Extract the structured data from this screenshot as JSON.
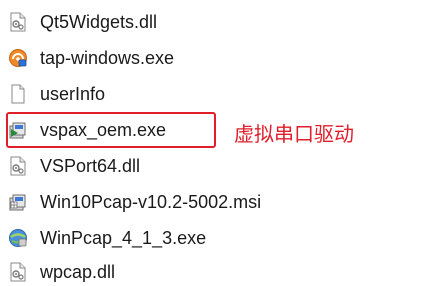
{
  "files": [
    {
      "name": "Qt5Widgets.dll",
      "icon": "dll-file-icon"
    },
    {
      "name": "tap-windows.exe",
      "icon": "tap-windows-exe-icon"
    },
    {
      "name": "userInfo",
      "icon": "blank-file-icon"
    },
    {
      "name": "vspax_oem.exe",
      "icon": "installer-exe-icon"
    },
    {
      "name": "VSPort64.dll",
      "icon": "dll-file-icon"
    },
    {
      "name": "Win10Pcap-v10.2-5002.msi",
      "icon": "msi-installer-icon"
    },
    {
      "name": "WinPcap_4_1_3.exe",
      "icon": "setup-exe-icon"
    },
    {
      "name": "wpcap.dll",
      "icon": "dll-file-icon"
    }
  ],
  "annotation": {
    "text": "虚拟串口驱动",
    "color": "#e11f2b"
  }
}
